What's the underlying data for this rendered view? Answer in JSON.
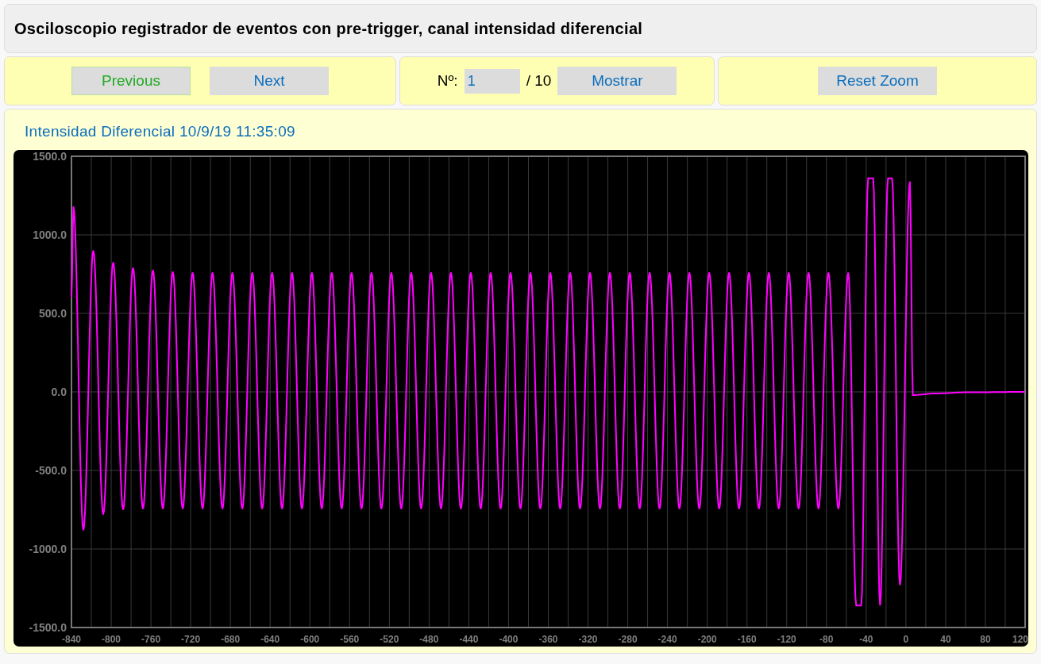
{
  "header": {
    "title": "Osciloscopio registrador de eventos con pre-trigger, canal intensidad diferencial"
  },
  "nav_buttons": [
    {
      "label": "Previous",
      "highlighted": true
    },
    {
      "label": "Next",
      "highlighted": false
    }
  ],
  "record_selector": {
    "label": "Nº:",
    "value": "1",
    "total": "/ 10",
    "button": "Mostrar"
  },
  "zoom_button": {
    "label": "Reset Zoom"
  },
  "chart_panel": {
    "title": "Intensidad Diferencial 10/9/19 11:35:09",
    "chart_data": {
      "type": "line",
      "grid": true,
      "xlim": [
        -840,
        120
      ],
      "ylim": [
        -1500,
        1500
      ],
      "xticks": [
        -840,
        -800,
        -760,
        -720,
        -680,
        -640,
        -600,
        -560,
        -520,
        -480,
        -440,
        -400,
        -360,
        -320,
        -280,
        -240,
        -200,
        -160,
        -120,
        -80,
        -40,
        0,
        40,
        80,
        120
      ],
      "yticks": [
        {
          "value": -1500,
          "label": "-1500.0"
        },
        {
          "value": -1000,
          "label": "-1000.0"
        },
        {
          "value": -500,
          "label": "-500.0"
        },
        {
          "value": 0,
          "label": "0.0"
        },
        {
          "value": 500,
          "label": "500.0"
        },
        {
          "value": 1000,
          "label": "1000.0"
        },
        {
          "value": 1500,
          "label": "1500.0"
        }
      ],
      "x": [
        -840,
        -838,
        -828,
        -818,
        -808,
        -798,
        -788,
        -778,
        -768,
        -758,
        -748,
        -738,
        -728,
        -718,
        -708,
        -698,
        -688,
        -678,
        -668,
        -658,
        -648,
        -638,
        -628,
        -618,
        -608,
        -598,
        -588,
        -578,
        -568,
        -558,
        -548,
        -538,
        -528,
        -518,
        -508,
        -498,
        -488,
        -478,
        -468,
        -458,
        -448,
        -438,
        -428,
        -418,
        -408,
        -398,
        -388,
        -378,
        -368,
        -358,
        -348,
        -338,
        -328,
        -318,
        -308,
        -298,
        -288,
        -278,
        -268,
        -258,
        -248,
        -238,
        -228,
        -218,
        -208,
        -198,
        -188,
        -178,
        -168,
        -158,
        -148,
        -138,
        -128,
        -118,
        -108,
        -98,
        -88,
        -78,
        -68,
        -58,
        -50,
        -45,
        -38,
        -33,
        -26,
        -18,
        -14,
        -6,
        4,
        7,
        30,
        60,
        120
      ],
      "series": [
        {
          "color": "#ff00ff",
          "values": [
            600,
            1180,
            -880,
            900,
            -780,
            825,
            -750,
            790,
            -745,
            775,
            -745,
            765,
            -745,
            760,
            -745,
            760,
            -745,
            760,
            -745,
            760,
            -745,
            760,
            -745,
            760,
            -745,
            760,
            -745,
            760,
            -745,
            760,
            -745,
            760,
            -745,
            760,
            -745,
            760,
            -745,
            760,
            -745,
            760,
            -745,
            760,
            -745,
            760,
            -745,
            760,
            -745,
            760,
            -745,
            760,
            -745,
            760,
            -745,
            760,
            -745,
            760,
            -745,
            760,
            -745,
            760,
            -745,
            760,
            -745,
            760,
            -745,
            760,
            -745,
            760,
            -745,
            760,
            -745,
            760,
            -745,
            760,
            -745,
            760,
            -745,
            760,
            -745,
            760,
            -1360,
            -1360,
            1360,
            1360,
            -1360,
            1360,
            1360,
            -1230,
            1340,
            -20,
            -10,
            -3,
            0
          ]
        }
      ]
    }
  }
}
